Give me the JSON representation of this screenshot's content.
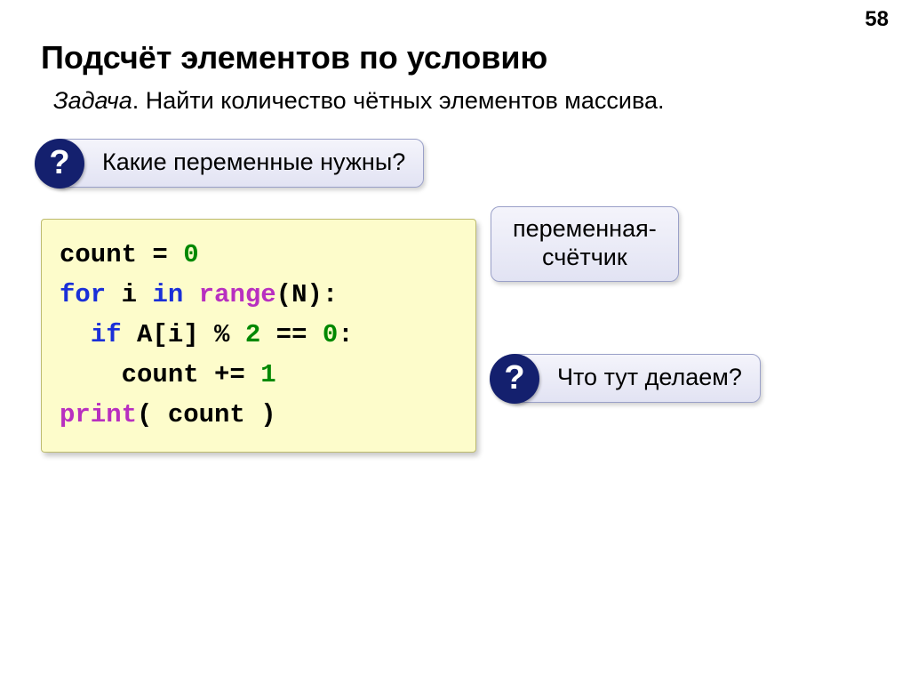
{
  "page_number": "58",
  "title": "Подсчёт элементов по условию",
  "task": {
    "label": "Задача",
    "text": ". Найти количество чётных элементов массива."
  },
  "callout1": "Какие переменные нужны?",
  "annotation_line1": "переменная-",
  "annotation_line2": "счётчик",
  "callout3": "Что тут делаем?",
  "badge": "?",
  "code": {
    "l1a": "count = ",
    "l1b": "0",
    "l2a": "for",
    "l2b": " i ",
    "l2c": "in",
    "l2d": " ",
    "l2e": "range",
    "l2f": "(N):",
    "l3a": "  ",
    "l3b": "if",
    "l3c": " A[i] % ",
    "l3d": "2",
    "l3e": " == ",
    "l3f": "0",
    "l3g": ":",
    "l4a": "    count += ",
    "l4b": "1",
    "l5a": "print",
    "l5b": "( count )"
  }
}
